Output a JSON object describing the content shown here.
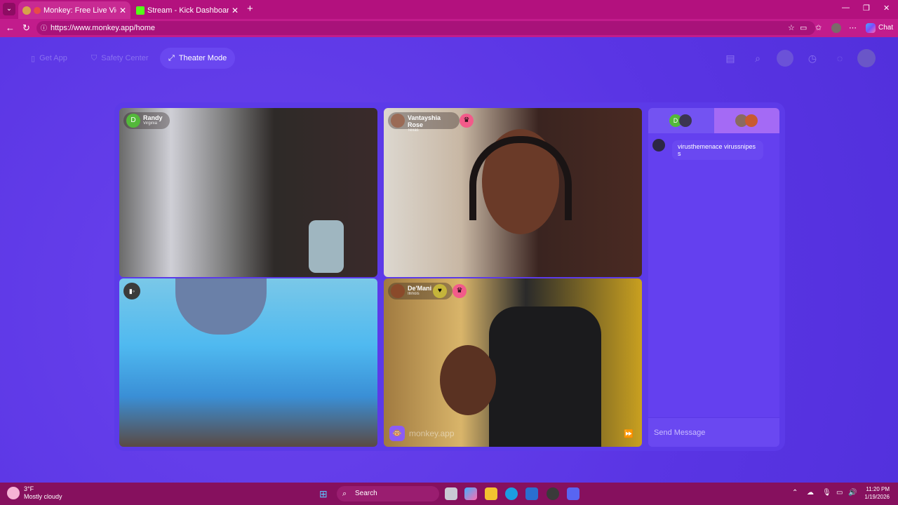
{
  "browser": {
    "tabs": [
      {
        "title": "Monkey: Free Live Video Chat",
        "active": true
      },
      {
        "title": "Stream - Kick Dashboard",
        "active": false
      }
    ],
    "url": "https://www.monkey.app/home",
    "chat_button": "Chat",
    "new_tab_symbol": "+"
  },
  "nav": {
    "get_app": "Get App",
    "safety_center": "Safety Center",
    "theater_mode": "Theater Mode"
  },
  "videos": [
    {
      "name": "Randy",
      "location": "Virginia",
      "avatar_letter": "D"
    },
    {
      "name": "Vantayshia Rose",
      "location": "Texas"
    },
    {
      "name": "",
      "location": ""
    },
    {
      "name": "De'Mani",
      "location": "Illinois",
      "watermark": "monkey.app"
    }
  ],
  "chat": {
    "tab1_avatar_letter": "D",
    "messages": [
      {
        "text": "virusthemenace virussnipes s"
      }
    ],
    "send_placeholder": "Send Message"
  },
  "taskbar": {
    "temperature": "3°F",
    "weather": "Mostly cloudy",
    "search": "Search",
    "time": "11:20 PM",
    "date": "1/19/2026"
  },
  "colors": {
    "page_bg": "#5b36e6",
    "browser_chrome": "#b3117e",
    "taskbar": "#86105e",
    "chat_panel": "#6440ef"
  }
}
